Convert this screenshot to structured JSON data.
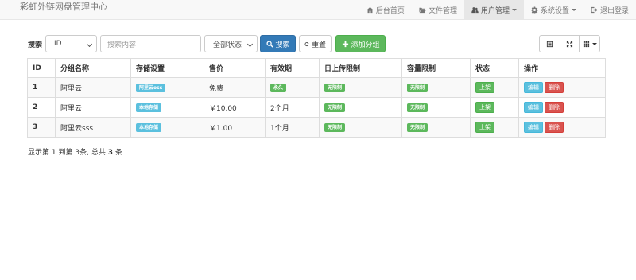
{
  "navbar": {
    "brand": "彩虹外链网盘管理中心",
    "items": [
      {
        "label": "后台首页",
        "icon": "home-icon"
      },
      {
        "label": "文件管理",
        "icon": "folder-open-icon"
      },
      {
        "label": "用户管理",
        "icon": "users-icon",
        "active": true,
        "dropdown": true
      },
      {
        "label": "系统设置",
        "icon": "gear-icon",
        "dropdown": true
      },
      {
        "label": "退出登录",
        "icon": "sign-out-icon"
      }
    ]
  },
  "toolbar": {
    "search_label": "搜索",
    "field_select": "ID",
    "search_placeholder": "搜索内容",
    "status_select": "全部状态",
    "search_button": "搜索",
    "reset_button": "重置",
    "add_button": "添加分组"
  },
  "table": {
    "headers": [
      "ID",
      "分组名称",
      "存储设置",
      "售价",
      "有效期",
      "日上传限制",
      "容量限制",
      "状态",
      "操作"
    ],
    "rows": [
      {
        "id": "1",
        "name": "阿里云",
        "storage": "阿里云oss",
        "price": "免费",
        "validity": "永久",
        "upload_limit": "无限制",
        "capacity_limit": "无限制",
        "status": "上架",
        "edit": "编辑",
        "delete": "删除"
      },
      {
        "id": "2",
        "name": "阿里云",
        "storage": "本地存储",
        "price": "￥10.00",
        "validity": "2个月",
        "upload_limit": "无限制",
        "capacity_limit": "无限制",
        "status": "上架",
        "edit": "编辑",
        "delete": "删除"
      },
      {
        "id": "3",
        "name": "阿里云sss",
        "storage": "本地存储",
        "price": "￥1.00",
        "validity": "1个月",
        "upload_limit": "无限制",
        "capacity_limit": "无限制",
        "status": "上架",
        "edit": "编辑",
        "delete": "删除"
      }
    ]
  },
  "pagination": {
    "prefix": "显示第",
    "from": "1",
    "mid1": "到第",
    "to": "3",
    "mid2": "条, 总共",
    "total": "3",
    "suffix": "条"
  },
  "colors": {
    "primary": "#337ab7",
    "success": "#5cb85c",
    "info": "#5bc0de",
    "danger": "#d9534f"
  }
}
